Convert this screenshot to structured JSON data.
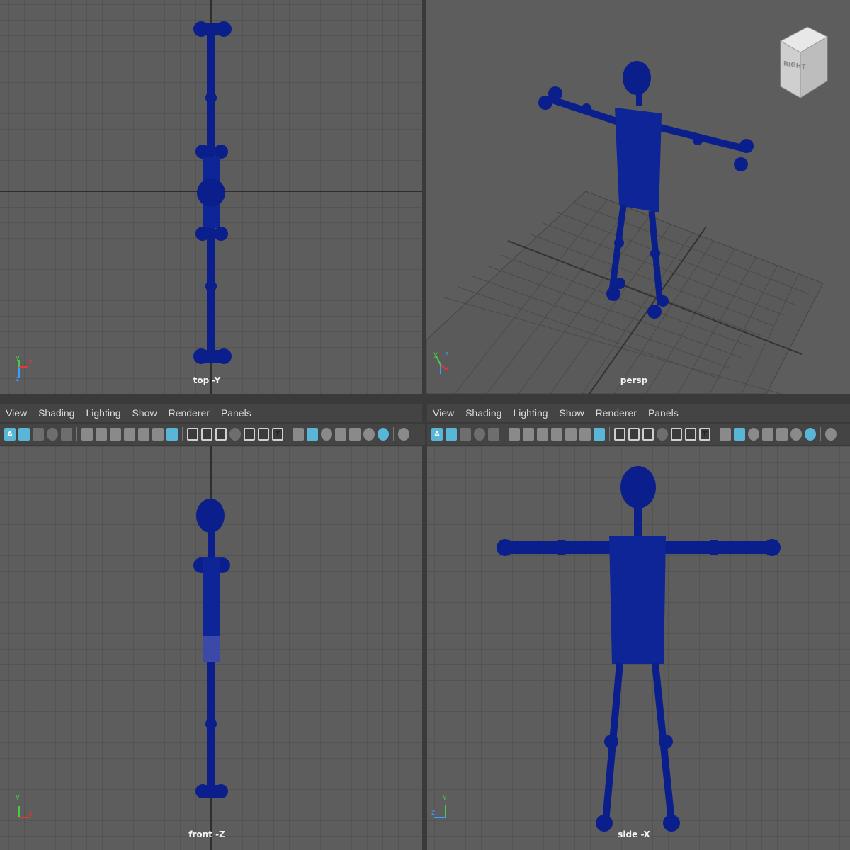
{
  "viewports": {
    "top": {
      "label": "top -Y"
    },
    "persp": {
      "label": "persp",
      "viewcube_label": "RIGHT"
    },
    "front": {
      "label": "front -Z"
    },
    "side": {
      "label": "side -X"
    }
  },
  "menu": [
    "View",
    "Shading",
    "Lighting",
    "Show",
    "Renderer",
    "Panels"
  ],
  "axes": {
    "x": "x",
    "y": "y",
    "z": "z"
  },
  "toolbar_icons": [
    "select-camera-icon",
    "camera-attributes-icon",
    "bookmarks-icon",
    "image-plane-icon",
    "grid-icon",
    "film-gate-icon",
    "resolution-gate-icon",
    "gate-mask-icon",
    "field-chart-icon",
    "safe-action-icon",
    "safe-title-icon",
    "wireframe-icon",
    "smooth-shade-icon",
    "default-material-icon",
    "xray-icon",
    "lights-icon",
    "shadows-icon",
    "isolate-icon"
  ],
  "colors": {
    "model": "#0a1f8c",
    "model_dark": "#071662",
    "viewport_bg": "#5d5d5d",
    "grid": "#4a4a4a",
    "grid_axis": "#333333",
    "panel": "#444444",
    "accent": "#59b6d6"
  }
}
